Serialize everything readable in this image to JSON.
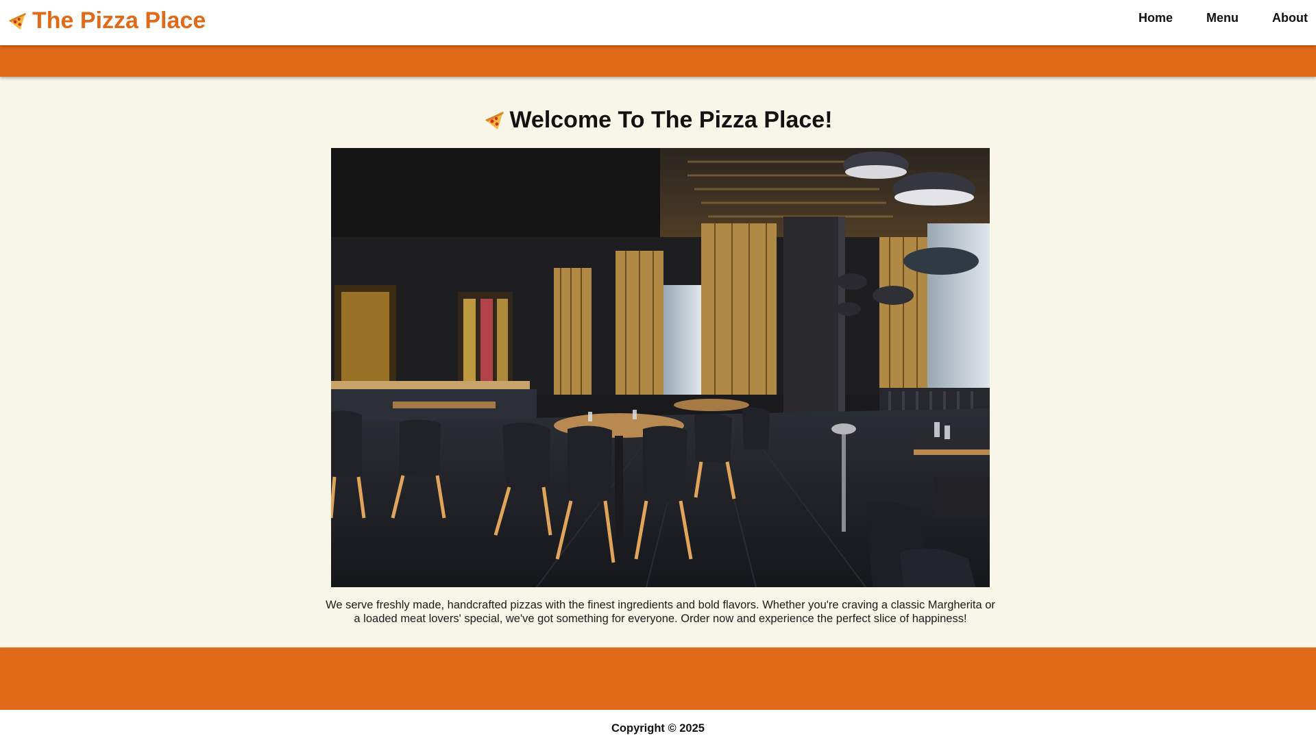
{
  "header": {
    "brand": "The Pizza Place",
    "brand_icon": "pizza-slice-icon",
    "nav": [
      {
        "label": "Home"
      },
      {
        "label": "Menu"
      },
      {
        "label": "About"
      }
    ]
  },
  "main": {
    "welcome_title": "Welcome To The Pizza Place!",
    "welcome_icon": "pizza-slice-icon",
    "hero_image": "restaurant-interior-photo",
    "description": "We serve freshly made, handcrafted pizzas with the finest ingredients and bold flavors. Whether you're craving a classic Margherita or a loaded meat lovers' special, we've got something for everyone. Order now and experience the perfect slice of happiness!"
  },
  "footer": {
    "copyright": "Copyright © 2025"
  },
  "colors": {
    "accent": "#e06a17",
    "background": "#f8f5e9",
    "text": "#111111"
  }
}
